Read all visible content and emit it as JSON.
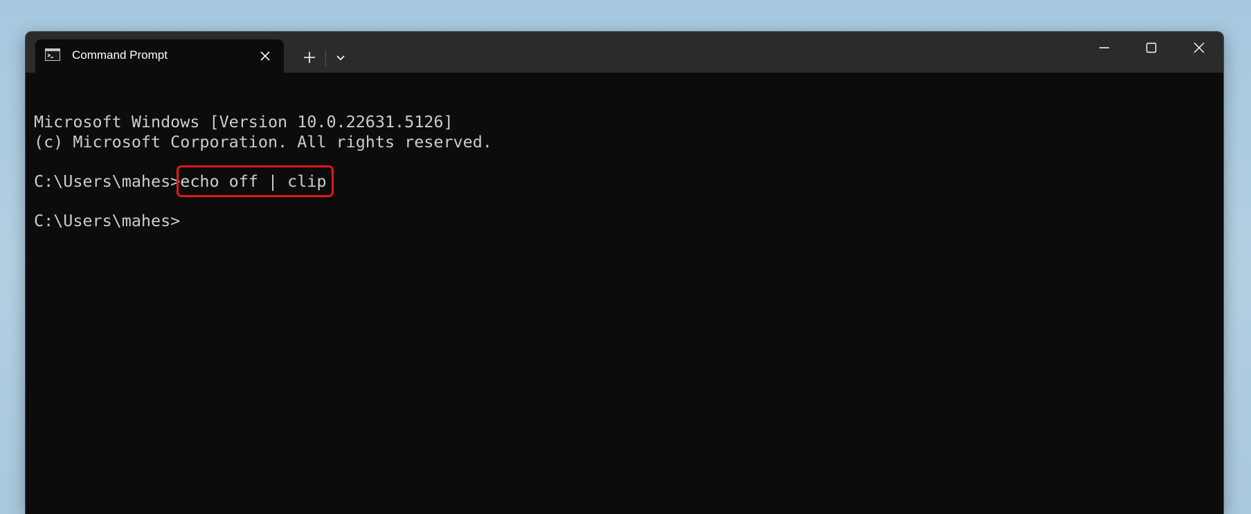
{
  "window": {
    "tab_title": "Command Prompt",
    "tab_icon": "terminal-icon",
    "new_tab_icon": "plus-icon",
    "dropdown_icon": "chevron-down-icon",
    "minimize_icon": "minimize-icon",
    "maximize_icon": "maximize-icon",
    "close_icon": "close-icon"
  },
  "terminal": {
    "banner_line1": "Microsoft Windows [Version 10.0.22631.5126]",
    "banner_line2": "(c) Microsoft Corporation. All rights reserved.",
    "prompt1": "C:\\Users\\mahes>",
    "command1": "echo off | clip",
    "prompt2": "C:\\Users\\mahes>"
  },
  "colors": {
    "terminal_background": "#0c0c0c",
    "terminal_text": "#cccccc",
    "titlebar_background": "#2b2b2b",
    "highlight_box": "#e01919"
  }
}
